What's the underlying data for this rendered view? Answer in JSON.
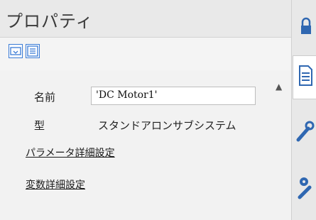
{
  "header": {
    "title": "プロパティ"
  },
  "toolbar": {
    "buttons": [
      {
        "icon": "category-view-icon"
      },
      {
        "icon": "list-view-icon"
      }
    ]
  },
  "properties": {
    "name_label": "名前",
    "name_value": "'DC Motor1'",
    "type_label": "型",
    "type_value": "スタンドアロンサブシステム"
  },
  "links": {
    "param_detail": "パラメータ詳細設定",
    "var_detail": "変数詳細設定"
  },
  "right_tabs": [
    {
      "icon": "lock-icon"
    },
    {
      "icon": "document-icon"
    },
    {
      "icon": "wrench-icon"
    },
    {
      "icon": "settings-wrench-icon"
    }
  ],
  "colors": {
    "accent": "#3a7bd5",
    "tool_icon": "#2f67b1"
  }
}
